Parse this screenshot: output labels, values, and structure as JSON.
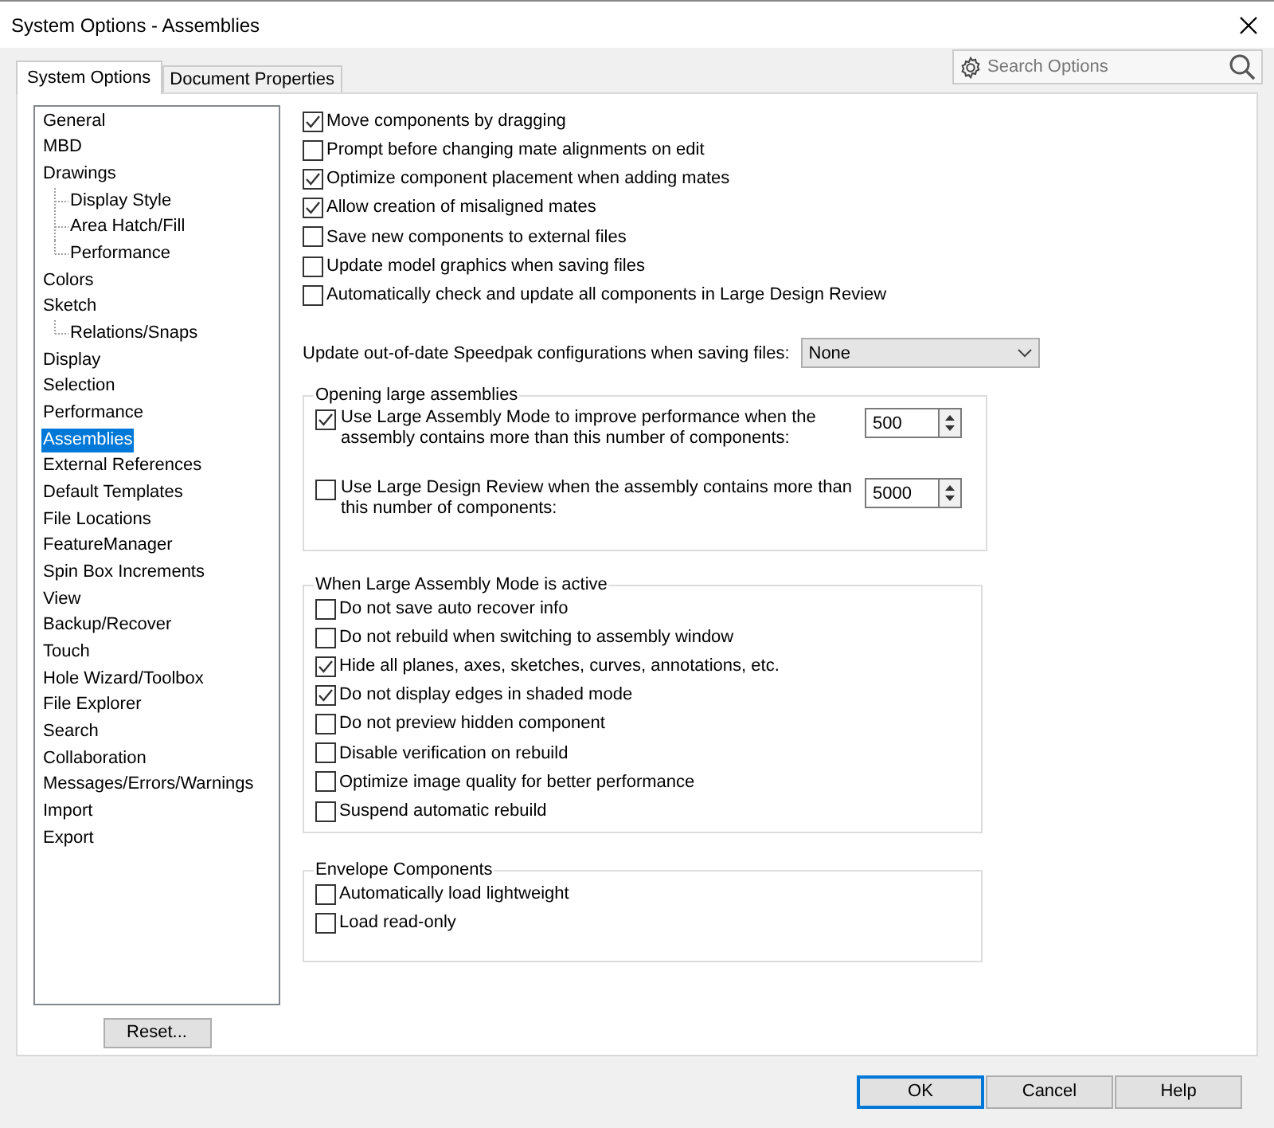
{
  "window": {
    "title": "System Options - Assemblies"
  },
  "tabs": [
    {
      "label": "System Options",
      "selected": true
    },
    {
      "label": "Document Properties",
      "selected": false
    }
  ],
  "search": {
    "placeholder": "Search Options"
  },
  "tree": [
    {
      "label": "General",
      "selected": false
    },
    {
      "label": "MBD",
      "selected": false
    },
    {
      "label": "Drawings",
      "selected": false,
      "children": [
        {
          "label": "Display Style",
          "selected": false
        },
        {
          "label": "Area Hatch/Fill",
          "selected": false
        },
        {
          "label": "Performance",
          "selected": false
        }
      ]
    },
    {
      "label": "Colors",
      "selected": false
    },
    {
      "label": "Sketch",
      "selected": false,
      "children": [
        {
          "label": "Relations/Snaps",
          "selected": false
        }
      ]
    },
    {
      "label": "Display",
      "selected": false
    },
    {
      "label": "Selection",
      "selected": false
    },
    {
      "label": "Performance",
      "selected": false
    },
    {
      "label": "Assemblies",
      "selected": true
    },
    {
      "label": "External References",
      "selected": false
    },
    {
      "label": "Default Templates",
      "selected": false
    },
    {
      "label": "File Locations",
      "selected": false
    },
    {
      "label": "FeatureManager",
      "selected": false
    },
    {
      "label": "Spin Box Increments",
      "selected": false
    },
    {
      "label": "View",
      "selected": false
    },
    {
      "label": "Backup/Recover",
      "selected": false
    },
    {
      "label": "Touch",
      "selected": false
    },
    {
      "label": "Hole Wizard/Toolbox",
      "selected": false
    },
    {
      "label": "File Explorer",
      "selected": false
    },
    {
      "label": "Search",
      "selected": false
    },
    {
      "label": "Collaboration",
      "selected": false
    },
    {
      "label": "Messages/Errors/Warnings",
      "selected": false
    },
    {
      "label": "Import",
      "selected": false
    },
    {
      "label": "Export",
      "selected": false
    }
  ],
  "reset_button": "Reset...",
  "options": [
    {
      "label": "Move components by dragging",
      "checked": true
    },
    {
      "label": "Prompt before changing mate alignments on edit",
      "checked": false
    },
    {
      "label": "Optimize component placement when adding mates",
      "checked": true
    },
    {
      "label": "Allow creation of misaligned mates",
      "checked": true
    },
    {
      "label": "Save new components to external files",
      "checked": false
    },
    {
      "label": "Update model graphics when saving files",
      "checked": false
    },
    {
      "label": "Automatically check and update all components in Large Design Review",
      "checked": false
    }
  ],
  "speedpak": {
    "label": "Update out-of-date Speedpak configurations when saving files:",
    "value": "None"
  },
  "groups": [
    {
      "title": "Opening large assemblies",
      "items": [
        {
          "kind": "spin",
          "label": "Use Large Assembly Mode to improve performance when the assembly contains more than this number of components:",
          "checked": true,
          "value": "500"
        },
        {
          "kind": "spin",
          "label": "Use Large Design Review when the assembly contains more than this number of components:",
          "checked": false,
          "value": "5000"
        }
      ]
    },
    {
      "title": "When Large Assembly Mode is active",
      "items": [
        {
          "kind": "check",
          "label": "Do not save auto recover info",
          "checked": false
        },
        {
          "kind": "check",
          "label": "Do not rebuild when switching to assembly window",
          "checked": false
        },
        {
          "kind": "check",
          "label": "Hide all planes, axes, sketches, curves, annotations, etc.",
          "checked": true
        },
        {
          "kind": "check",
          "label": "Do not display edges in shaded mode",
          "checked": true
        },
        {
          "kind": "check",
          "label": "Do not preview hidden component",
          "checked": false
        },
        {
          "kind": "check",
          "label": "Disable verification on rebuild",
          "checked": false
        },
        {
          "kind": "check",
          "label": "Optimize image quality for better performance",
          "checked": false
        },
        {
          "kind": "check",
          "label": "Suspend automatic rebuild",
          "checked": false
        }
      ]
    },
    {
      "title": "Envelope Components",
      "items": [
        {
          "kind": "check",
          "label": "Automatically load lightweight",
          "checked": false
        },
        {
          "kind": "check",
          "label": "Load read-only",
          "checked": false
        }
      ]
    }
  ],
  "buttons": [
    {
      "label": "OK",
      "default": true
    },
    {
      "label": "Cancel",
      "default": false
    },
    {
      "label": "Help",
      "default": false
    }
  ]
}
